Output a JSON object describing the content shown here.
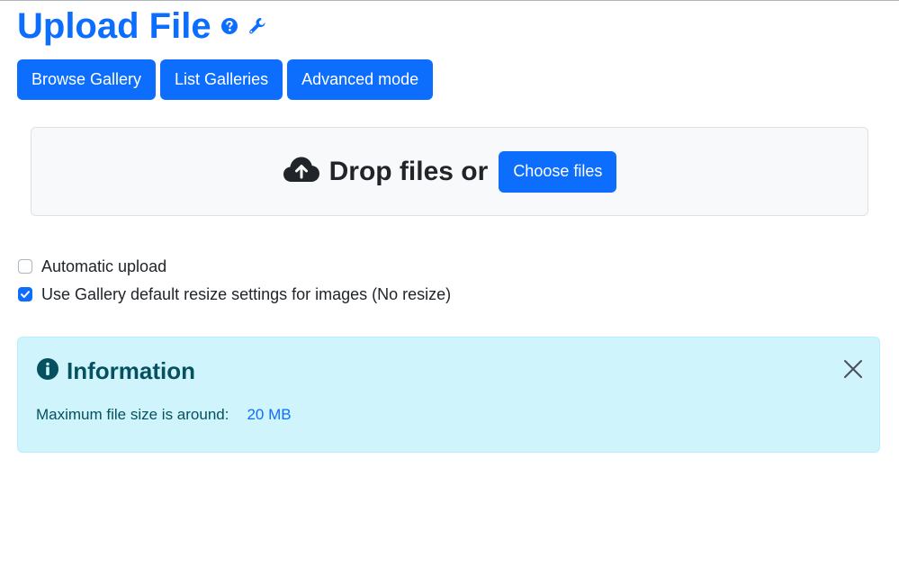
{
  "header": {
    "title": "Upload File",
    "icons": [
      "help-icon",
      "wrench-icon"
    ]
  },
  "toolbar": {
    "browse_gallery": "Browse Gallery",
    "list_galleries": "List Galleries",
    "advanced_mode": "Advanced mode"
  },
  "dropzone": {
    "icon": "cloud-upload-icon",
    "text": "Drop files or",
    "choose_label": "Choose files"
  },
  "options": [
    {
      "label": "Automatic upload",
      "checked": false
    },
    {
      "label": "Use Gallery default resize settings for images (No resize)",
      "checked": true
    }
  ],
  "info": {
    "icon": "info-icon",
    "title": "Information",
    "label": "Maximum file size is around:",
    "value": "20 MB"
  },
  "colors": {
    "primary": "#0d6efd",
    "info_bg": "#cff4fc",
    "info_text": "#055160"
  }
}
